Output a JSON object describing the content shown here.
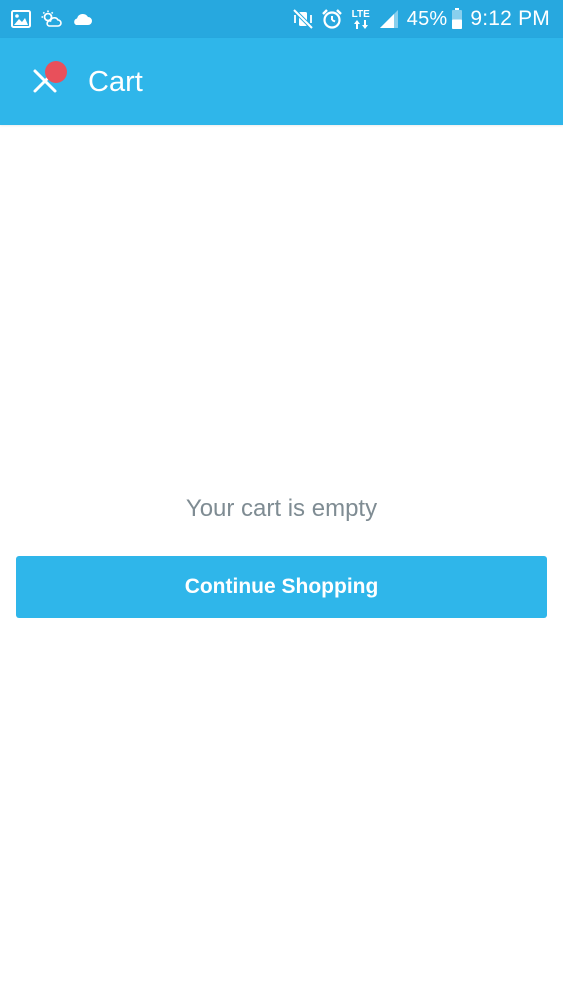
{
  "status_bar": {
    "left_icons": [
      "gallery-icon",
      "weather-icon",
      "cloud-icon"
    ],
    "right_icons": [
      "vibrate-mute-icon",
      "alarm-icon",
      "lte-icon",
      "signal-icon",
      "battery-icon"
    ],
    "lte_label": "LTE",
    "battery_percent": "45%",
    "time": "9:12 PM"
  },
  "app_bar": {
    "title": "Cart",
    "close_icon": "close-icon",
    "has_notification_dot": true
  },
  "cart": {
    "empty_message": "Your cart is empty",
    "continue_label": "Continue Shopping"
  },
  "colors": {
    "status_bar": "#27a8df",
    "app_bar": "#2fb6ea",
    "accent": "#2fb6ea",
    "notification_dot": "#e8505b",
    "empty_text": "#7f8c93",
    "background": "#ffffff"
  }
}
